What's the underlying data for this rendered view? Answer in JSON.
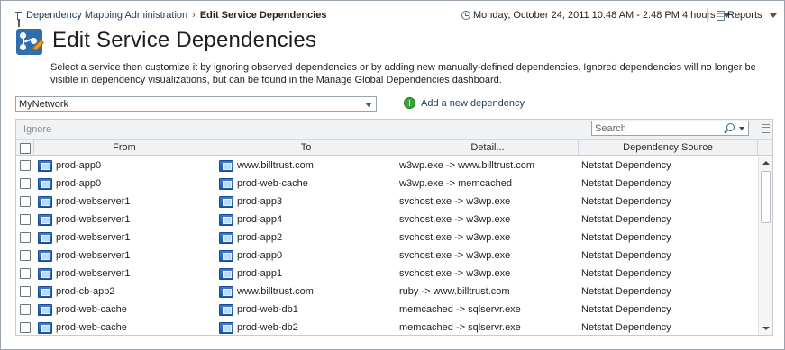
{
  "breadcrumb": {
    "parent": "Dependency Mapping Administration",
    "separator": "›",
    "current": "Edit Service Dependencies"
  },
  "time_range": {
    "label": "Monday, October 24, 2011 10:48 AM - 2:48 PM 4 hours"
  },
  "reports": {
    "label": "Reports"
  },
  "page": {
    "title": "Edit Service Dependencies",
    "description": "Select a service then customize it by ignoring observed dependencies or by adding new manually-defined dependencies. Ignored dependencies will no longer be visible in dependency visualizations, but can be found in the Manage Global Dependencies dashboard."
  },
  "network_select": {
    "value": "MyNetwork"
  },
  "add_dependency": {
    "label": "Add a new dependency"
  },
  "grid": {
    "toolbar": {
      "ignore_label": "Ignore",
      "search_placeholder": "Search"
    },
    "columns": [
      "From",
      "To",
      "Detail...",
      "Dependency Source"
    ],
    "rows": [
      {
        "from": "prod-app0",
        "to": "www.billtrust.com",
        "detail": "w3wp.exe -> www.billtrust.com",
        "source": "Netstat Dependency"
      },
      {
        "from": "prod-app0",
        "to": "prod-web-cache",
        "detail": "w3wp.exe -> memcached",
        "source": "Netstat Dependency"
      },
      {
        "from": "prod-webserver1",
        "to": "prod-app3",
        "detail": "svchost.exe -> w3wp.exe",
        "source": "Netstat Dependency"
      },
      {
        "from": "prod-webserver1",
        "to": "prod-app4",
        "detail": "svchost.exe -> w3wp.exe",
        "source": "Netstat Dependency"
      },
      {
        "from": "prod-webserver1",
        "to": "prod-app2",
        "detail": "svchost.exe -> w3wp.exe",
        "source": "Netstat Dependency"
      },
      {
        "from": "prod-webserver1",
        "to": "prod-app0",
        "detail": "svchost.exe -> w3wp.exe",
        "source": "Netstat Dependency"
      },
      {
        "from": "prod-webserver1",
        "to": "prod-app1",
        "detail": "svchost.exe -> w3wp.exe",
        "source": "Netstat Dependency"
      },
      {
        "from": "prod-cb-app2",
        "to": "www.billtrust.com",
        "detail": "ruby -> www.billtrust.com",
        "source": "Netstat Dependency"
      },
      {
        "from": "prod-web-cache",
        "to": "prod-web-db1",
        "detail": "memcached -> sqlservr.exe",
        "source": "Netstat Dependency"
      },
      {
        "from": "prod-web-cache",
        "to": "prod-web-db2",
        "detail": "memcached -> sqlservr.exe",
        "source": "Netstat Dependency"
      }
    ]
  }
}
